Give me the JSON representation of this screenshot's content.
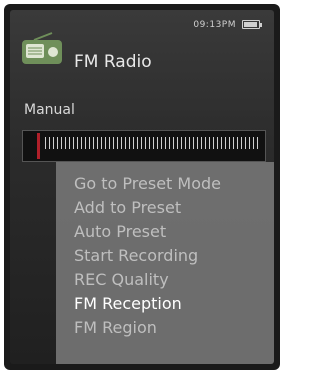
{
  "status": {
    "time": "09:13PM"
  },
  "header": {
    "title": "FM Radio",
    "icon": "radio-icon"
  },
  "mode_label": "Manual",
  "menu": {
    "items": [
      {
        "label": "Go to Preset Mode"
      },
      {
        "label": "Add to Preset"
      },
      {
        "label": "Auto Preset"
      },
      {
        "label": "Start Recording"
      },
      {
        "label": "REC Quality"
      },
      {
        "label": "FM Reception"
      },
      {
        "label": "FM Region"
      }
    ],
    "selected": "FM Reception"
  },
  "colors": {
    "needle": "#b0202a",
    "menu_bg": "#787878",
    "text_active": "#ffffff"
  }
}
